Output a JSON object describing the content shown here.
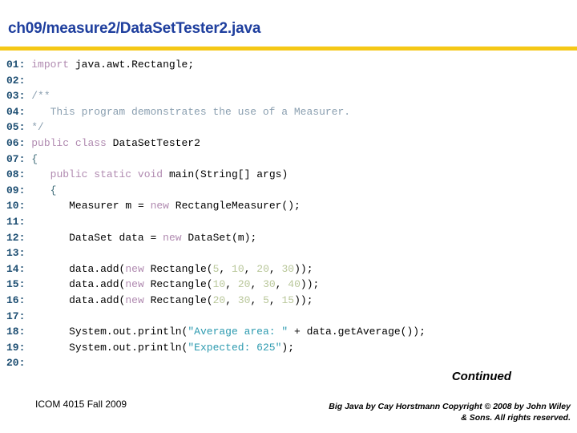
{
  "slide": {
    "title": "ch09/measure2/DataSetTester2.java",
    "rule_color": "#f5c816",
    "title_color": "#1f3f9e"
  },
  "code": {
    "language": "java",
    "colors": {
      "line_number": "#1d4e72",
      "keyword": "#b08ab0",
      "identifier": "#000000",
      "comment": "#8a9fb0",
      "string": "#2e9bb0",
      "number": "#b9c79a",
      "brace": "#3d6b78"
    },
    "lines": [
      {
        "num": "01:",
        "text": "import java.awt.Rectangle;"
      },
      {
        "num": "02:",
        "text": ""
      },
      {
        "num": "03:",
        "text": "/**"
      },
      {
        "num": "04:",
        "text": "   This program demonstrates the use of a Measurer."
      },
      {
        "num": "05:",
        "text": "*/"
      },
      {
        "num": "06:",
        "text": "public class DataSetTester2"
      },
      {
        "num": "07:",
        "text": "{"
      },
      {
        "num": "08:",
        "text": "   public static void main(String[] args)"
      },
      {
        "num": "09:",
        "text": "   {"
      },
      {
        "num": "10:",
        "text": "      Measurer m = new RectangleMeasurer();"
      },
      {
        "num": "11:",
        "text": ""
      },
      {
        "num": "12:",
        "text": "      DataSet data = new DataSet(m);"
      },
      {
        "num": "13:",
        "text": ""
      },
      {
        "num": "14:",
        "text": "      data.add(new Rectangle(5, 10, 20, 30));"
      },
      {
        "num": "15:",
        "text": "      data.add(new Rectangle(10, 20, 30, 40));"
      },
      {
        "num": "16:",
        "text": "      data.add(new Rectangle(20, 30, 5, 15));"
      },
      {
        "num": "17:",
        "text": ""
      },
      {
        "num": "18:",
        "text": "      System.out.println(\"Average area: \" + data.getAverage());"
      },
      {
        "num": "19:",
        "text": "      System.out.println(\"Expected: 625\");"
      },
      {
        "num": "20:",
        "text": ""
      }
    ]
  },
  "footer": {
    "continued": "Continued",
    "course": "ICOM 4015 Fall 2009",
    "copyright_line1": "Big Java by Cay Horstmann Copyright © 2008 by John Wiley",
    "copyright_line2": "& Sons.  All rights reserved."
  }
}
